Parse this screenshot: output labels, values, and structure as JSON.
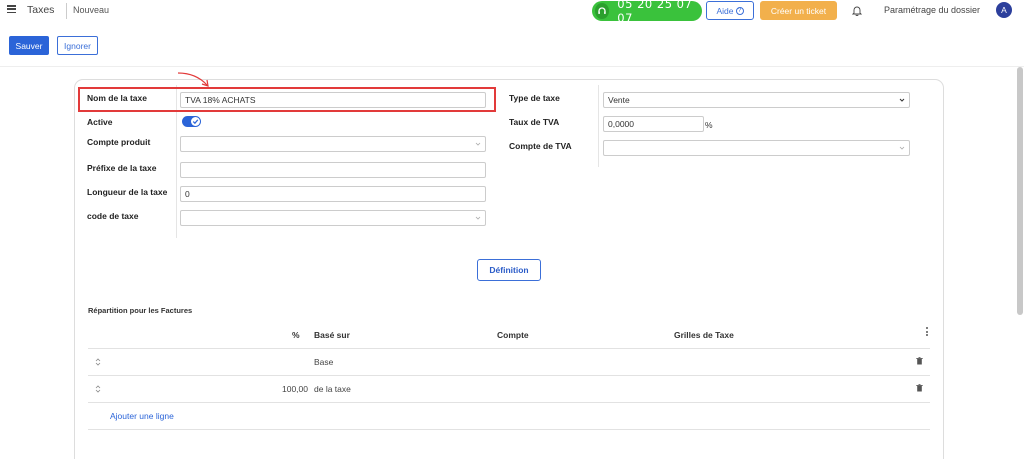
{
  "app": {
    "title": "Taxes",
    "breadcrumb": "Nouveau"
  },
  "topbar": {
    "phone_number": "05 20 25 07 07",
    "help_label": "Aide",
    "help_icon": "question-circle-icon",
    "ticket_label": "Créer un ticket",
    "settings_label": "Paramétrage du dossier",
    "avatar_initial": "A",
    "colors": {
      "phone": "#3ac23c",
      "ticket": "#f2b04c",
      "primary": "#2b64d8",
      "highlight": "#e23a3a"
    }
  },
  "actions": {
    "save_label": "Sauver",
    "ignore_label": "Ignorer"
  },
  "form": {
    "tax_name": {
      "label": "Nom de la taxe",
      "value": "TVA 18% ACHATS"
    },
    "active": {
      "label": "Active",
      "checked": true
    },
    "product_account": {
      "label": "Compte produit",
      "value": ""
    },
    "tax_prefix": {
      "label": "Préfixe de la taxe",
      "value": ""
    },
    "tax_length": {
      "label": "Longueur de la taxe",
      "value": "0"
    },
    "tax_code": {
      "label": "code de taxe",
      "value": ""
    },
    "tax_type": {
      "label": "Type de taxe",
      "value": "Vente"
    },
    "vat_rate": {
      "label": "Taux de TVA",
      "value": "0,0000",
      "unit": "%"
    },
    "vat_account": {
      "label": "Compte de TVA",
      "value": ""
    }
  },
  "definition_button": "Définition",
  "distribution": {
    "title": "Répartition pour les Factures",
    "columns": [
      "%",
      "Basé sur",
      "Compte",
      "Grilles de Taxe"
    ],
    "rows": [
      {
        "percent": "",
        "based_on": "Base",
        "account": "",
        "grids": ""
      },
      {
        "percent": "100,00",
        "based_on": "de la taxe",
        "account": "",
        "grids": ""
      }
    ],
    "add_line_label": "Ajouter une ligne"
  }
}
